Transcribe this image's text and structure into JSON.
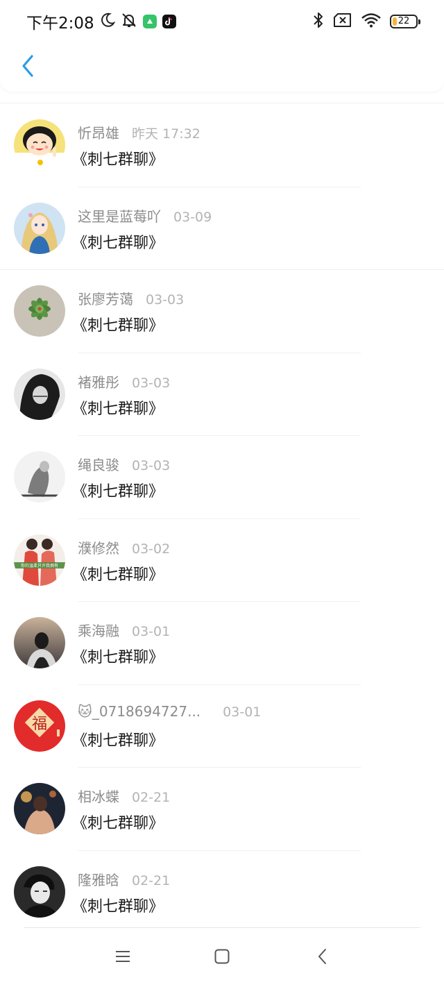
{
  "status_bar": {
    "time": "下午2:08",
    "battery_level": "22",
    "battery_fraction": 0.22,
    "icons": [
      "moon-icon",
      "mute-bell-icon",
      "app-notification-icon",
      "tiktok-icon",
      "bluetooth-icon",
      "no-sim-icon",
      "wifi-icon",
      "battery-icon"
    ]
  },
  "header": {
    "back_icon": "chevron-left-icon",
    "accent_color": "#2b9bea"
  },
  "list": [
    {
      "name": "忻昂雄",
      "time": "昨天 17:32",
      "message": "《刺七群聊》",
      "avatar": "cartoon-girl-avatar"
    },
    {
      "name": "这里是蓝莓吖",
      "time": "03-09",
      "message": "《刺七群聊》",
      "avatar": "anime-girl-avatar"
    },
    {
      "name": "张廖芳蔼",
      "time": "03-03",
      "message": "《刺七群聊》",
      "avatar": "succulent-avatar"
    },
    {
      "name": "褚雅彤",
      "time": "03-03",
      "message": "《刺七群聊》",
      "avatar": "bw-portrait-avatar"
    },
    {
      "name": "绳良骏",
      "time": "03-03",
      "message": "《刺七群聊》",
      "avatar": "bw-figure-avatar"
    },
    {
      "name": "濮修然",
      "time": "03-02",
      "message": "《刺七群聊》",
      "avatar": "couple-avatar"
    },
    {
      "name": "乘海融",
      "time": "03-01",
      "message": "《刺七群聊》",
      "avatar": "dusk-portrait-avatar"
    },
    {
      "name": "🐱_0718694727...",
      "time": "03-01",
      "message": "《刺七群聊》",
      "avatar": "fu-avatar"
    },
    {
      "name": "相冰蝶",
      "time": "02-21",
      "message": "《刺七群聊》",
      "avatar": "night-photo-avatar"
    },
    {
      "name": "隆雅晗",
      "time": "02-21",
      "message": "《刺七群聊》",
      "avatar": "dark-portrait-avatar"
    }
  ],
  "fu_avatar_text": "福",
  "couple_avatar_caption": "你的温柔只许我拥有",
  "nav_bar": {
    "icons": [
      "menu-icon",
      "home-icon",
      "back-icon"
    ]
  }
}
